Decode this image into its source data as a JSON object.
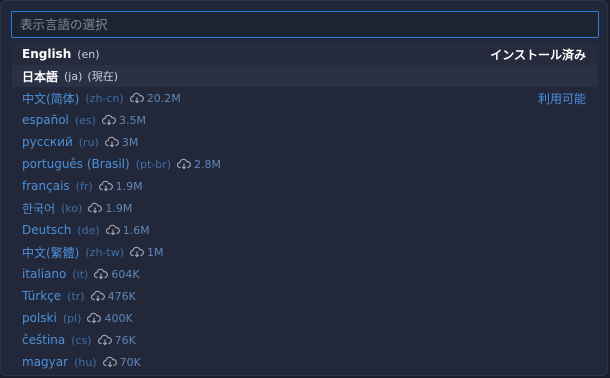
{
  "search": {
    "placeholder": "表示言語の選択",
    "value": ""
  },
  "installed": [
    {
      "name": "English",
      "code": "(en)",
      "current": "",
      "badge": "インストール済み"
    },
    {
      "name": "日本語",
      "code": "(ja)",
      "current": "(現在)"
    }
  ],
  "available_badge": "利用可能",
  "available": [
    {
      "name": "中文(简体)",
      "code": "(zh-cn)",
      "size": "20.2M"
    },
    {
      "name": "español",
      "code": "(es)",
      "size": "3.5M"
    },
    {
      "name": "русский",
      "code": "(ru)",
      "size": "3M"
    },
    {
      "name": "português (Brasil)",
      "code": "(pt-br)",
      "size": "2.8M"
    },
    {
      "name": "français",
      "code": "(fr)",
      "size": "1.9M"
    },
    {
      "name": "한국어",
      "code": "(ko)",
      "size": "1.9M"
    },
    {
      "name": "Deutsch",
      "code": "(de)",
      "size": "1.6M"
    },
    {
      "name": "中文(繁體)",
      "code": "(zh-tw)",
      "size": "1M"
    },
    {
      "name": "italiano",
      "code": "(it)",
      "size": "604K"
    },
    {
      "name": "Türkçe",
      "code": "(tr)",
      "size": "476K"
    },
    {
      "name": "polski",
      "code": "(pl)",
      "size": "400K"
    },
    {
      "name": "čeština",
      "code": "(cs)",
      "size": "76K"
    },
    {
      "name": "magyar",
      "code": "(hu)",
      "size": "70K"
    }
  ],
  "colors": {
    "accent": "#2d7bd6",
    "link": "#4d8fd8",
    "background": "#22283a"
  },
  "icons": {
    "download": "cloud-download-icon"
  }
}
